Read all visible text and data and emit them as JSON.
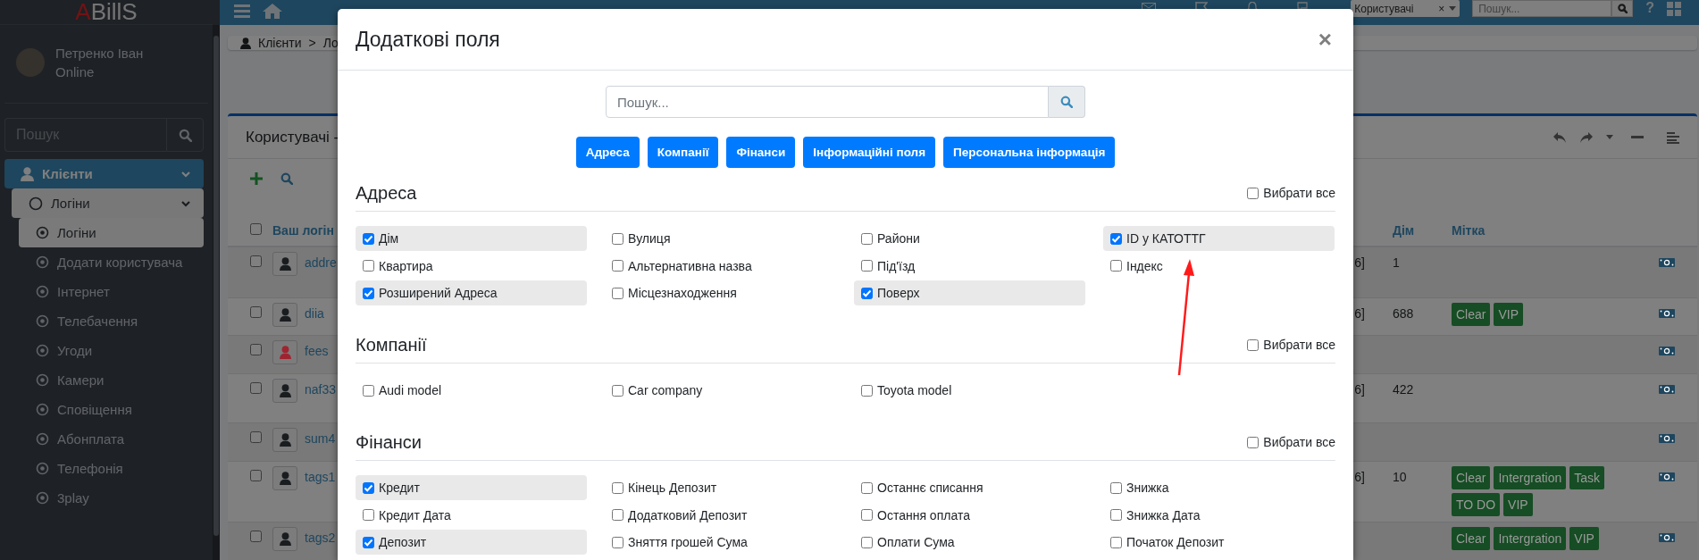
{
  "navbar": {
    "select": {
      "value": "Користувачі",
      "clear": "×"
    },
    "search": {
      "placeholder": "Пошук..."
    },
    "help": "?"
  },
  "sidebar": {
    "logo": {
      "mark": "A",
      "text": "BillS"
    },
    "user": {
      "name": "Петренко Іван",
      "status": "Online"
    },
    "search": {
      "placeholder": "Пошук"
    },
    "menu": [
      {
        "label": "Клієнти",
        "selected": true,
        "expanded": true,
        "children": [
          {
            "label": "Логіни",
            "selected": true,
            "expanded": true,
            "children": [
              {
                "label": "Логіни",
                "selected": true
              },
              {
                "label": "Додати користувача",
                "selected": false
              },
              {
                "label": "Інтернет",
                "selected": false
              },
              {
                "label": "Телебачення",
                "selected": false
              },
              {
                "label": "Угоди",
                "selected": false
              },
              {
                "label": "Камери",
                "selected": false
              },
              {
                "label": "Сповіщення",
                "selected": false
              },
              {
                "label": "Абонплата",
                "selected": false
              },
              {
                "label": "Телефонія",
                "selected": false
              },
              {
                "label": "3play",
                "selected": false
              }
            ]
          }
        ]
      }
    ]
  },
  "content": {
    "breadcrumb": [
      "Клієнти",
      "Ло"
    ],
    "breadcrumb_separator": ">",
    "panel": {
      "title": "Користувачі -",
      "select_all_checked": false,
      "columns": [
        "Ваш логін",
        "Дім",
        "Мітка"
      ],
      "rows": [
        {
          "login": "addre",
          "color": "#1a1d20",
          "checked": false,
          "code": "6]",
          "house": "1"
        },
        {
          "login": "diia",
          "color": "#1a1d20",
          "checked": false,
          "code": "6]",
          "house": "688",
          "tags": [
            "Clear",
            "VIP"
          ]
        },
        {
          "login": "fees",
          "color": "#9e2530",
          "checked": false
        },
        {
          "login": "naf33",
          "color": "#1a1d20",
          "checked": false,
          "code": "6]",
          "house": "422"
        },
        {
          "login": "sum4",
          "color": "#1a1d20",
          "checked": false
        },
        {
          "login": "tags1",
          "color": "#1a1d20",
          "checked": false,
          "code": "6]",
          "house": "10",
          "tags": [
            "Clear",
            "Intergration",
            "Task",
            "TO DO",
            "VIP"
          ]
        },
        {
          "login": "tags2",
          "color": "#1a1d20",
          "checked": false,
          "tags": [
            "Clear",
            "Intergration",
            "VIP"
          ]
        }
      ]
    }
  },
  "modal": {
    "title": "Додаткові поля",
    "close": "×",
    "search": {
      "placeholder": "Пошук..."
    },
    "filters": [
      "Адреса",
      "Компанії",
      "Фінанси",
      "Інформаційні поля",
      "Персональна інформація"
    ],
    "sections": [
      {
        "title": "Адреса",
        "select_all": {
          "label": "Вибрати все",
          "checked": false
        },
        "fields": [
          {
            "label": "Дім",
            "checked": true
          },
          {
            "label": "Вулиця",
            "checked": false
          },
          {
            "label": "Райони",
            "checked": false
          },
          {
            "label": "ID у КАТОТТГ",
            "checked": true
          },
          {
            "label": "Квартира",
            "checked": false
          },
          {
            "label": "Альтернативна назва",
            "checked": false
          },
          {
            "label": "Під'їзд",
            "checked": false
          },
          {
            "label": "Індекс",
            "checked": false
          },
          {
            "label": "Розширений Адреса",
            "checked": true
          },
          {
            "label": "Місцезнаходження",
            "checked": false
          },
          {
            "label": "Поверх",
            "checked": true
          }
        ]
      },
      {
        "title": "Компанії",
        "select_all": {
          "label": "Вибрати все",
          "checked": false
        },
        "fields": [
          {
            "label": "Audi model",
            "checked": false
          },
          {
            "label": "Car company",
            "checked": false
          },
          {
            "label": "Toyota model",
            "checked": false
          }
        ]
      },
      {
        "title": "Фінанси",
        "select_all": {
          "label": "Вибрати все",
          "checked": false
        },
        "fields": [
          {
            "label": "Кредит",
            "checked": true
          },
          {
            "label": "Кінець Депозит",
            "checked": false
          },
          {
            "label": "Останнє списання",
            "checked": false
          },
          {
            "label": "Знижка",
            "checked": false
          },
          {
            "label": "Кредит Дата",
            "checked": false
          },
          {
            "label": "Додатковий Депозит",
            "checked": false
          },
          {
            "label": "Остання оплата",
            "checked": false
          },
          {
            "label": "Знижка Дата",
            "checked": false
          },
          {
            "label": "Депозит",
            "checked": true
          },
          {
            "label": "Зняття грошей Сума",
            "checked": false
          },
          {
            "label": "Оплати Сума",
            "checked": false
          },
          {
            "label": "Початок Депозит",
            "checked": false
          }
        ]
      }
    ]
  }
}
